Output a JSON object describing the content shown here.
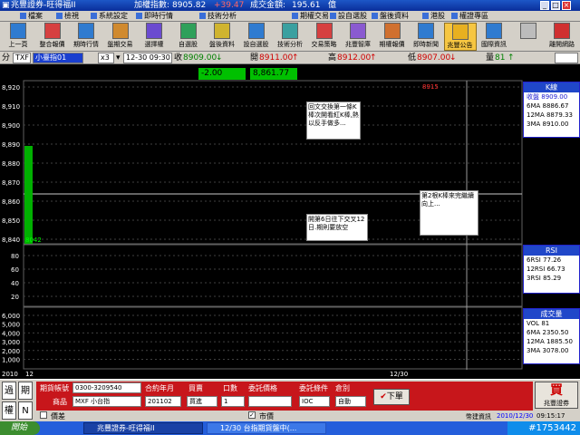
{
  "window": {
    "title": "兆豐證券-旺得福II",
    "index_label": "加權指數:",
    "index_value": "8905.82",
    "index_change": "+39.47",
    "turnover_label": "成交金額:",
    "turnover_value": "195.61",
    "turnover_unit": "億"
  },
  "menu": [
    "檔案",
    "檢視",
    "系統設定",
    "即時行情",
    "技術分析",
    "期權交易",
    "設自選股",
    "盤後資料",
    "港股",
    "權證專區"
  ],
  "toolbar": [
    "上一頁",
    "整合報價",
    "期時行情",
    "盤期交易",
    "選擇權",
    "自選股",
    "盤後資料",
    "設自選股",
    "技術分析",
    "交易策略",
    "兆豐智庫",
    "期權報價",
    "即時新聞",
    "兆豐公告",
    "國際資訊",
    "",
    "離開網路"
  ],
  "quote": {
    "tab": "分",
    "symbol": "TXF",
    "name": "小臺指01",
    "multiplier": "x3",
    "datetime": "12-30 09:30",
    "close_label": "收",
    "close": "8909.00",
    "open_label": "開",
    "open": "8911.00",
    "high_label": "高",
    "high": "8912.00",
    "low_label": "低",
    "low": "8907.00",
    "volume_label": "量",
    "volume": "81",
    "change": "-2.00",
    "last": "8,861.77"
  },
  "main_chart": {
    "y_ticks": [
      "8,920",
      "8,910",
      "8,900",
      "8,890",
      "8,880",
      "8,870",
      "8,860",
      "8,850",
      "8,840"
    ],
    "marker_value": "8042",
    "peak_label": "8915",
    "legend": {
      "title": "K線",
      "rows": [
        {
          "label": "收盤",
          "value": "8909.00",
          "color": "#1a1ad0"
        },
        {
          "label": "6MA",
          "value": "8886.67",
          "color": "#000000"
        },
        {
          "label": "12MA",
          "value": "8879.33",
          "color": "#000000"
        },
        {
          "label": "3MA",
          "value": "8910.00",
          "color": "#000000"
        }
      ]
    }
  },
  "notes": [
    "回文交換第一條K棒次開看紅K棒,熱以反手做多...",
    "開第6日往下交叉12日.期則要放空",
    "第2根K棒來完繼續向上..."
  ],
  "rsi_chart": {
    "y_ticks": [
      "80",
      "60",
      "40",
      "20"
    ],
    "legend": {
      "title": "RSI",
      "rows": [
        {
          "label": "6RSI",
          "value": "77.26"
        },
        {
          "label": "12RSI",
          "value": "66.73"
        },
        {
          "label": "3RSI",
          "value": "85.29"
        }
      ]
    }
  },
  "volume_chart": {
    "y_ticks": [
      "6,000",
      "5,000",
      "4,000",
      "3,000",
      "2,000",
      "1,000"
    ],
    "legend": {
      "title": "成交量",
      "rows": [
        {
          "label": "VOL",
          "value": "81"
        },
        {
          "label": "6MA",
          "value": "2350.50"
        },
        {
          "label": "12MA",
          "value": "1885.50"
        },
        {
          "label": "3MA",
          "value": "3078.00"
        }
      ]
    }
  },
  "x_axis": {
    "left": "2010",
    "left2": "12",
    "right": "12/30"
  },
  "order": {
    "side_buy": "買",
    "side_sell": "賣",
    "btn1": "過",
    "btn2": "期",
    "btn3": "權",
    "btn4": "N",
    "account_label": "期貨帳號",
    "account": "0300-3209540",
    "product_label": "商品",
    "product": "MXF 小台指",
    "month_label": "合約年月",
    "month": "201102",
    "bs_label": "買賣",
    "bs": "買進",
    "qty_label": "口數",
    "qty": "1",
    "price_label": "委託價格",
    "price": "",
    "cond_label": "委託條件",
    "cond": "IOC",
    "oc_label": "倉別",
    "oc": "自動",
    "limit_label": "價差",
    "market_label": "市價",
    "submit": "下單",
    "brand": "兆豐證券",
    "status_left": "幣建資訊",
    "status_date": "2010/12/30",
    "status_time": "09:15:17"
  },
  "taskbar": {
    "start": "開始",
    "task1": "兆豐證券-旺得福II",
    "task2": "12/30 台指期貨盤中(...",
    "clock": "#1753442"
  }
}
